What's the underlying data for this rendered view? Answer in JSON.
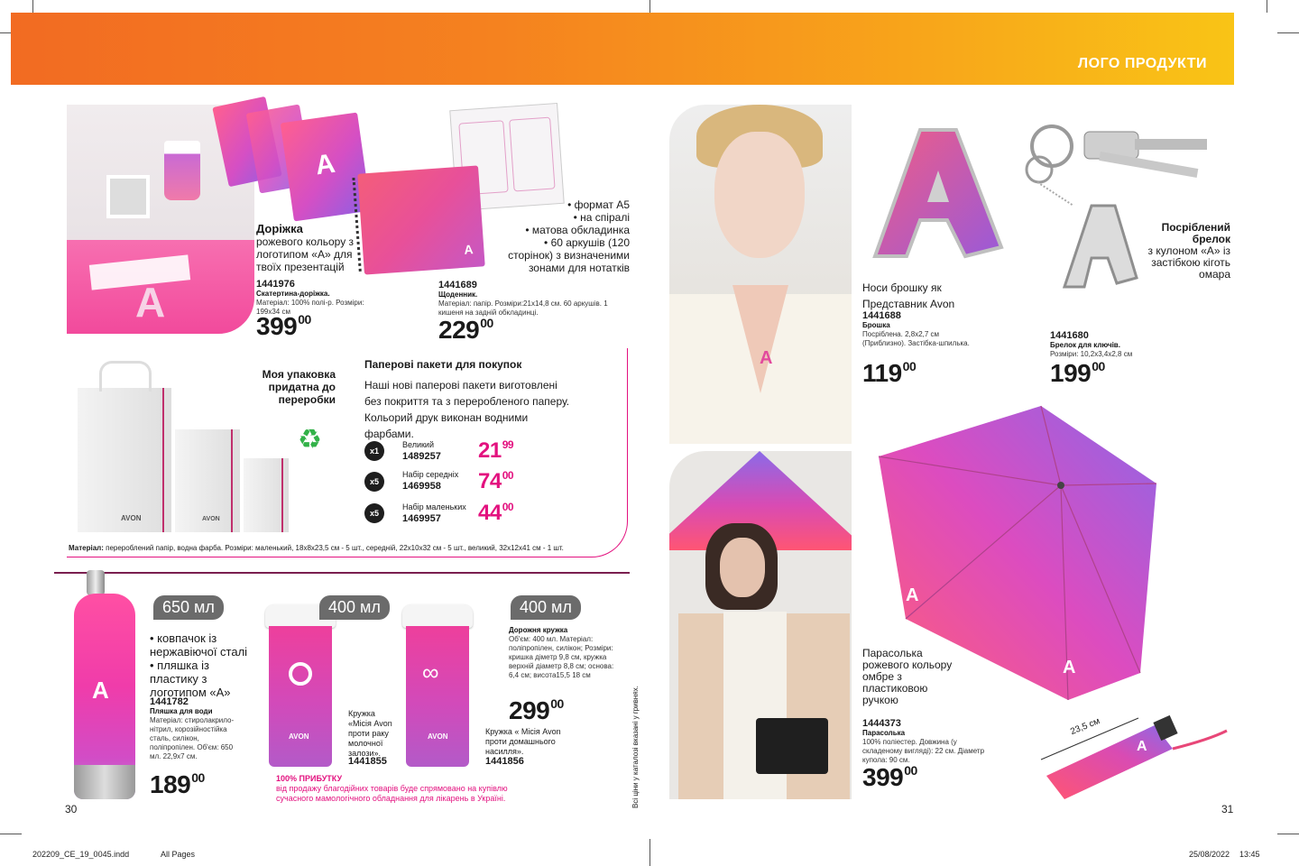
{
  "header": {
    "title": "ЛОГО ПРОДУКТИ"
  },
  "runner": {
    "title": "Доріжка",
    "desc": "рожевого кольору з логотипом «А» для твоїх презентацій",
    "code": "1441976",
    "name": "Скатертина-доріжка.",
    "details": "Матеріал: 100% полі-р. Розміри: 199x34 см",
    "price_main": "399",
    "price_cents": "00"
  },
  "notebook": {
    "bullets": [
      "• формат А5",
      "• на спіралі",
      "• матова обкладинка",
      "• 60 аркушів (120 сторінок) з визначеними зонами для нотатків"
    ],
    "code": "1441689",
    "name": "Щоденник.",
    "details": "Матеріал: папір. Розміри:21x14,8 см. 60 аркушів. 1 кишеня на задній обкладинці.",
    "price_main": "229",
    "price_cents": "00"
  },
  "bags": {
    "slogan": "Моя упаковка придатна до переробки",
    "title": "Паперові пакети для покупок",
    "desc": "Наші нові паперові пакети виготовлені без покриття та з переробленого паперу. Кольорий друк виконан водними фарбами.",
    "brand": "AVON",
    "items": [
      {
        "qty": "x1",
        "name": "Великий",
        "code": "1489257",
        "price_main": "21",
        "price_cents": "99"
      },
      {
        "qty": "x5",
        "name": "Набір середніх",
        "code": "1469958",
        "price_main": "74",
        "price_cents": "00"
      },
      {
        "qty": "x5",
        "name": "Набір маленьких",
        "code": "1469957",
        "price_main": "44",
        "price_cents": "00"
      }
    ],
    "material_label": "Матеріал:",
    "material": " перероблений папір, водна фарба. Розміри: маленький, 18x8x23,5 см - 5 шт., середній, 22x10x32 см - 5 шт., великий, 32x12x41 см - 1 шт."
  },
  "bottle": {
    "volume": "650 мл",
    "bullets": [
      "• ковпачок із нержавіючої сталі",
      "• пляшка із пластику з логотипом «А»"
    ],
    "code": "1441782",
    "name": "Пляшка для води",
    "details": "Матеріал: стиролакрило-нітрил, корозійностійка сталь, силікон, поліпропілен. Об'єм: 650 мл. 22,9x7 см.",
    "price_main": "189",
    "price_cents": "00"
  },
  "mug1": {
    "volume": "400 мл",
    "desc": "Кружка «Місія Avon проти раку молочної залози».",
    "code": "1441855"
  },
  "mug2": {
    "volume": "400 мл",
    "title": "Дорожня кружка",
    "details": "Об'єм: 400 мл. Матеріал: поліпропілен, силікон; Розміри: кришка діметр 9,8 см, кружка верхній діаметр 8,8 см; основа: 6,4 см; висота15,5 18 см",
    "price_main": "299",
    "price_cents": "00",
    "desc": "Кружка « Місія Avon проти домашнього насилля».",
    "code": "1441856"
  },
  "charity": {
    "title": "100% ПРИБУТКУ",
    "text": "від продажу благодійних товарів буде спрямовано на купівлю сучасного мамологічного обладнання для лікарень в Україні."
  },
  "vertical_note": "Всі ціни у каталозі вказані у гривнях.",
  "brooch": {
    "desc": "Носи брошку як Представник Avon",
    "code": "1441688",
    "name": "Брошка",
    "details": "Посріблена. 2,8x2,7 см (Приблизно). Застібка-шпилька.",
    "price_main": "119",
    "price_cents": "00"
  },
  "keychain": {
    "title": "Посріблений брелок",
    "desc": "з кулоном «А» із застібкою кіготь омара",
    "code": "1441680",
    "name": "Брелок для ключів.",
    "details": "Розміри: 10,2x3,4x2,8 см",
    "price_main": "199",
    "price_cents": "00"
  },
  "umbrella": {
    "desc": "Парасолька рожевого кольору омбре з пластиковою ручкою",
    "code": "1444373",
    "name": "Парасолька",
    "details": "100% поліестер. Довжина (у складеному вигляді): 22 см. Діаметр купола: 90 см.",
    "price_main": "399",
    "price_cents": "00",
    "folded_size": "23,5 см"
  },
  "pages": {
    "left": "30",
    "right": "31"
  },
  "slug": {
    "file": "202209_CE_19_0045.indd",
    "pages": "All Pages",
    "date": "25/08/2022",
    "time": "13:45"
  }
}
